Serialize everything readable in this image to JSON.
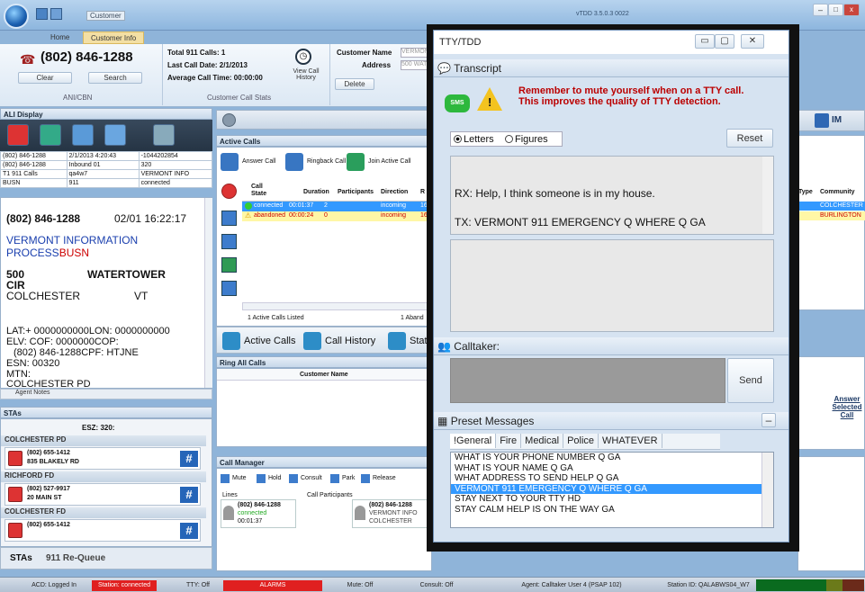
{
  "app": {
    "tab_home": "Home",
    "tab_customer": "Customer Info",
    "customer_label": "Customer",
    "right_title": "vTDD 3.5.0.3 0022"
  },
  "ani": {
    "phone": "(802) 846-1288",
    "clear": "Clear",
    "search": "Search",
    "group": "ANI/CBN"
  },
  "stats": {
    "total": "Total 911 Calls: 1",
    "last": "Last Call Date: 2/1/2013",
    "avg": "Average Call Time: 00:00:00",
    "view_history": "View Call History",
    "group": "Customer Call Stats"
  },
  "customer": {
    "name_label": "Customer Name",
    "name_value": "VERMONT",
    "address_label": "Address",
    "address_value": "500 WAT",
    "delete": "Delete"
  },
  "ali": {
    "header": "ALI Display",
    "grid": [
      [
        "(802) 846-1288",
        "2/1/2013 4:20:43",
        "-1044202854"
      ],
      [
        "(802) 846-1288",
        "Inbound 01",
        "320"
      ],
      [
        "T1 911 Calls",
        "qa4w7",
        "VERMONT INFO"
      ],
      [
        "BUSN",
        "911",
        "connected"
      ]
    ],
    "phone": "(802) 846-1288",
    "date": "02/01 16:22:17",
    "company": "VERMONT INFORMATION",
    "process": "PROCESS",
    "busn": "BUSN",
    "num": "500",
    "street": "WATERTOWER",
    "cir": "CIR",
    "city": "COLCHESTER",
    "state": "VT",
    "lat": "LAT:+ 0000000000LON: 0000000000",
    "elv": "ELV:  COF: 0000000COP:",
    "cpf": "(802) 846-1288CPF: HTJNE",
    "esn": "ESN: 00320",
    "mtn": "MTN:",
    "cut": "COLCHESTER PD",
    "agent_notes": "Agent Notes"
  },
  "stas": {
    "header": "STAs",
    "esz": "ESZ: 320:",
    "items": [
      {
        "name": "COLCHESTER PD",
        "phone": "(802) 655-1412",
        "addr": "835 BLAKELY RD"
      },
      {
        "name": "RICHFORD FD",
        "phone": "(802) 527-9917",
        "addr": "20 MAIN ST"
      },
      {
        "name": "COLCHESTER FD",
        "phone": "(802) 655-1412",
        "addr": ""
      }
    ],
    "tab1": "STAs",
    "tab2": "911 Re-Queue"
  },
  "active": {
    "header": "Active Calls",
    "answer": "Answer Call",
    "ringback": "Ringback Call",
    "join": "Join Active Call",
    "cols": [
      "Call State",
      "Duration",
      "Participants",
      "Direction",
      "R"
    ],
    "rows": [
      {
        "state": "connected",
        "dur": "00:01:37",
        "part": "2",
        "dir": "incoming",
        "r": "16"
      },
      {
        "state": "abandoned",
        "dur": "00:00:24",
        "part": "0",
        "dir": "incoming",
        "r": "16"
      }
    ],
    "footer_left": "1 Active Calls Listed",
    "footer_right": "1 Aband",
    "tab1": "Active Calls",
    "tab2": "Call History",
    "tab3": "Stati"
  },
  "ring": {
    "header": "Ring All Calls",
    "col": "Customer Name"
  },
  "cm": {
    "header": "Call Manager",
    "mute": "Mute",
    "hold": "Hold",
    "consult": "Consult",
    "park": "Park",
    "release": "Release",
    "lines": "Lines",
    "participants": "Call Participants",
    "line_phone": "(802) 846-1288",
    "line_state": "connected",
    "line_time": "00:01:37",
    "p_phone": "(802) 846-1288",
    "p_name": "VERMONT INFO",
    "p_city": "COLCHESTER"
  },
  "right": {
    "im": "IM",
    "type_col": "Type",
    "community_col": "Community",
    "c1": "COLCHESTER",
    "c2": "BURLINGTON",
    "answer_selected": "Answer Selected Call"
  },
  "tty": {
    "title": "TTY/TDD",
    "transcript": "Transcript",
    "sms": "SMS",
    "warning": "Remember to mute yourself when on a TTY call.  This improves the quality of TTY detection.",
    "letters": "Letters",
    "figures": "Figures",
    "reset": "Reset",
    "rx": "RX: Help, I think someone is in my house.",
    "tx": "TX: VERMONT 911 EMERGENCY Q WHERE Q GA",
    "calltaker": "Calltaker:",
    "send": "Send",
    "preset": "Preset Messages",
    "minus": "–",
    "tabs": [
      "!General",
      "Fire",
      "Medical",
      "Police",
      "WHATEVER"
    ],
    "messages": [
      "WHAT IS YOUR PHONE NUMBER Q GA",
      "WHAT IS YOUR NAME Q GA",
      "WHAT ADDRESS TO SEND HELP Q GA",
      "VERMONT 911 EMERGENCY Q WHERE Q GA",
      "STAY NEXT TO YOUR TTY HD",
      "STAY CALM HELP IS ON THE WAY GA"
    ],
    "selected_index": 3
  },
  "status": {
    "acd": "ACD: Logged In",
    "station": "Station: connected",
    "tty": "TTY: Off",
    "alarms": "ALARMS",
    "mute": "Mute: Off",
    "consult": "Consult: Off",
    "agent": "Agent: Calltaker User 4 (PSAP 102)",
    "station_id": "Station ID: QALABWS04_W7"
  },
  "colors": {
    "accent": "#3399ff",
    "alarm": "#e02020",
    "warning_text": "#cc0000"
  }
}
